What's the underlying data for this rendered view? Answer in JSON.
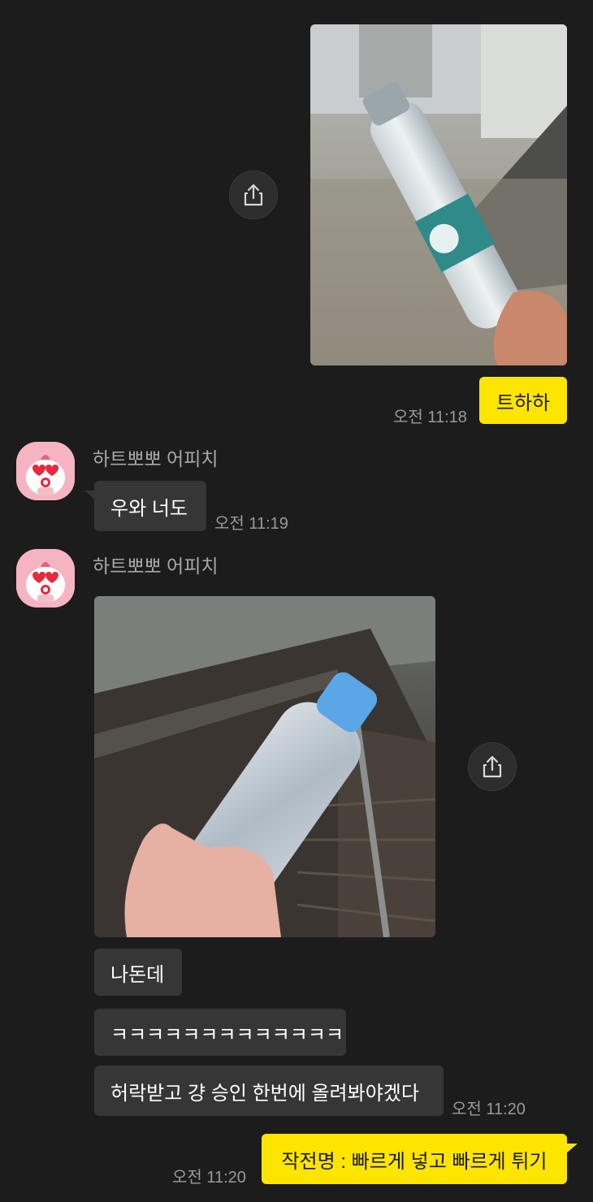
{
  "colors": {
    "background": "#1c1c1c",
    "my_bubble": "#fee500",
    "other_bubble": "#363636",
    "time_text": "#9a9a9a",
    "sender_text": "#a8a8a8"
  },
  "messages": {
    "m1": {
      "type": "image",
      "sender": "me",
      "content": "water-bottle-photo-1"
    },
    "m2": {
      "text": "트하하",
      "time": "오전 11:18"
    },
    "m3": {
      "sender_name": "하트뽀뽀 어피치",
      "text": "우와 너도",
      "time": "오전 11:19"
    },
    "m4": {
      "sender_name": "하트뽀뽀 어피치",
      "image": "water-bottle-photo-2"
    },
    "m5": {
      "text": "나돈데"
    },
    "m6": {
      "text": "ㅋㅋㅋㅋㅋㅋㅋㅋㅋㅋㅋㅋㅋ"
    },
    "m7": {
      "text": "허락받고 걍 승인 한번에 올려봐야겠다",
      "time": "오전 11:20"
    },
    "m8": {
      "text": "작전명 : 빠르게 넣고 빠르게 튀기",
      "time": "오전 11:20"
    }
  },
  "icons": {
    "share": "share-icon",
    "avatar": "apeach-heart-avatar"
  }
}
